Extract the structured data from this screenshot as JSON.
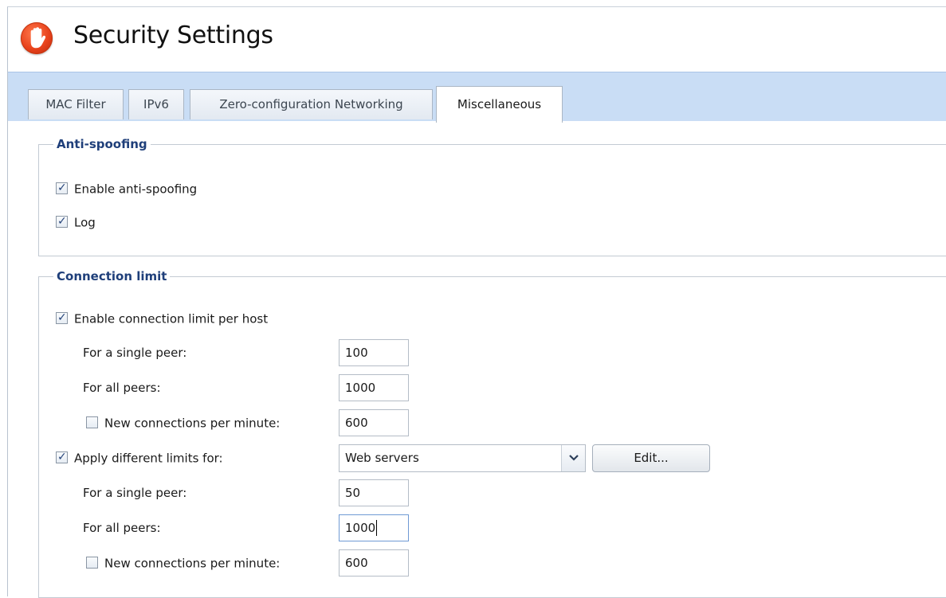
{
  "header": {
    "title": "Security Settings",
    "icon": "stop-hand-icon"
  },
  "tabs": [
    {
      "label": "MAC Filter",
      "active": false
    },
    {
      "label": "IPv6",
      "active": false
    },
    {
      "label": "Zero-configuration Networking",
      "active": false
    },
    {
      "label": "Miscellaneous",
      "active": true
    }
  ],
  "anti_spoofing": {
    "legend": "Anti-spoofing",
    "enable_label": "Enable anti-spoofing",
    "enable_checked": true,
    "log_label": "Log",
    "log_checked": true
  },
  "connection_limit": {
    "legend": "Connection limit",
    "enable_label": "Enable connection limit per host",
    "enable_checked": true,
    "single_peer_label": "For a single peer:",
    "single_peer_value": "100",
    "all_peers_label": "For all peers:",
    "all_peers_value": "1000",
    "new_conn_label": "New connections per minute:",
    "new_conn_checked": false,
    "new_conn_value": "600",
    "apply_label": "Apply different limits for:",
    "apply_checked": true,
    "apply_target": "Web servers",
    "edit_label": "Edit...",
    "diff_single_peer_label": "For a single peer:",
    "diff_single_peer_value": "50",
    "diff_all_peers_label": "For all peers:",
    "diff_all_peers_value": "1000",
    "diff_new_conn_label": "New connections per minute:",
    "diff_new_conn_checked": false,
    "diff_new_conn_value": "600"
  },
  "colors": {
    "tab_strip": "#c9ddf5",
    "legend_text": "#1f3f7a",
    "icon_red": "#e8421c"
  }
}
